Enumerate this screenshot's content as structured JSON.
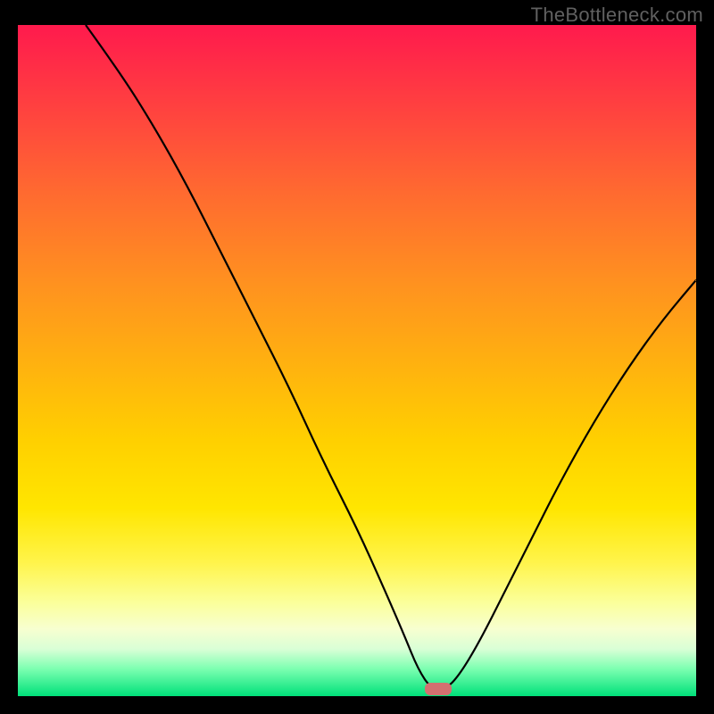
{
  "watermark": "TheBottleneck.com",
  "colors": {
    "frame": "#000000",
    "curve": "#000000",
    "marker": "#d37070"
  },
  "chart_data": {
    "type": "line",
    "title": "",
    "xlabel": "",
    "ylabel": "",
    "xlim": [
      0,
      100
    ],
    "ylim": [
      0,
      100
    ],
    "marker": {
      "x": 62,
      "y": 1
    },
    "series": [
      {
        "name": "curve",
        "points": [
          {
            "x": 10,
            "y": 100
          },
          {
            "x": 15,
            "y": 93
          },
          {
            "x": 20,
            "y": 85
          },
          {
            "x": 25,
            "y": 76
          },
          {
            "x": 30,
            "y": 66
          },
          {
            "x": 35,
            "y": 56
          },
          {
            "x": 40,
            "y": 46
          },
          {
            "x": 45,
            "y": 35
          },
          {
            "x": 50,
            "y": 25
          },
          {
            "x": 54,
            "y": 16
          },
          {
            "x": 57,
            "y": 9
          },
          {
            "x": 59,
            "y": 4
          },
          {
            "x": 61,
            "y": 1
          },
          {
            "x": 63,
            "y": 1
          },
          {
            "x": 65,
            "y": 3
          },
          {
            "x": 68,
            "y": 8
          },
          {
            "x": 72,
            "y": 16
          },
          {
            "x": 76,
            "y": 24
          },
          {
            "x": 80,
            "y": 32
          },
          {
            "x": 85,
            "y": 41
          },
          {
            "x": 90,
            "y": 49
          },
          {
            "x": 95,
            "y": 56
          },
          {
            "x": 100,
            "y": 62
          }
        ]
      }
    ]
  }
}
